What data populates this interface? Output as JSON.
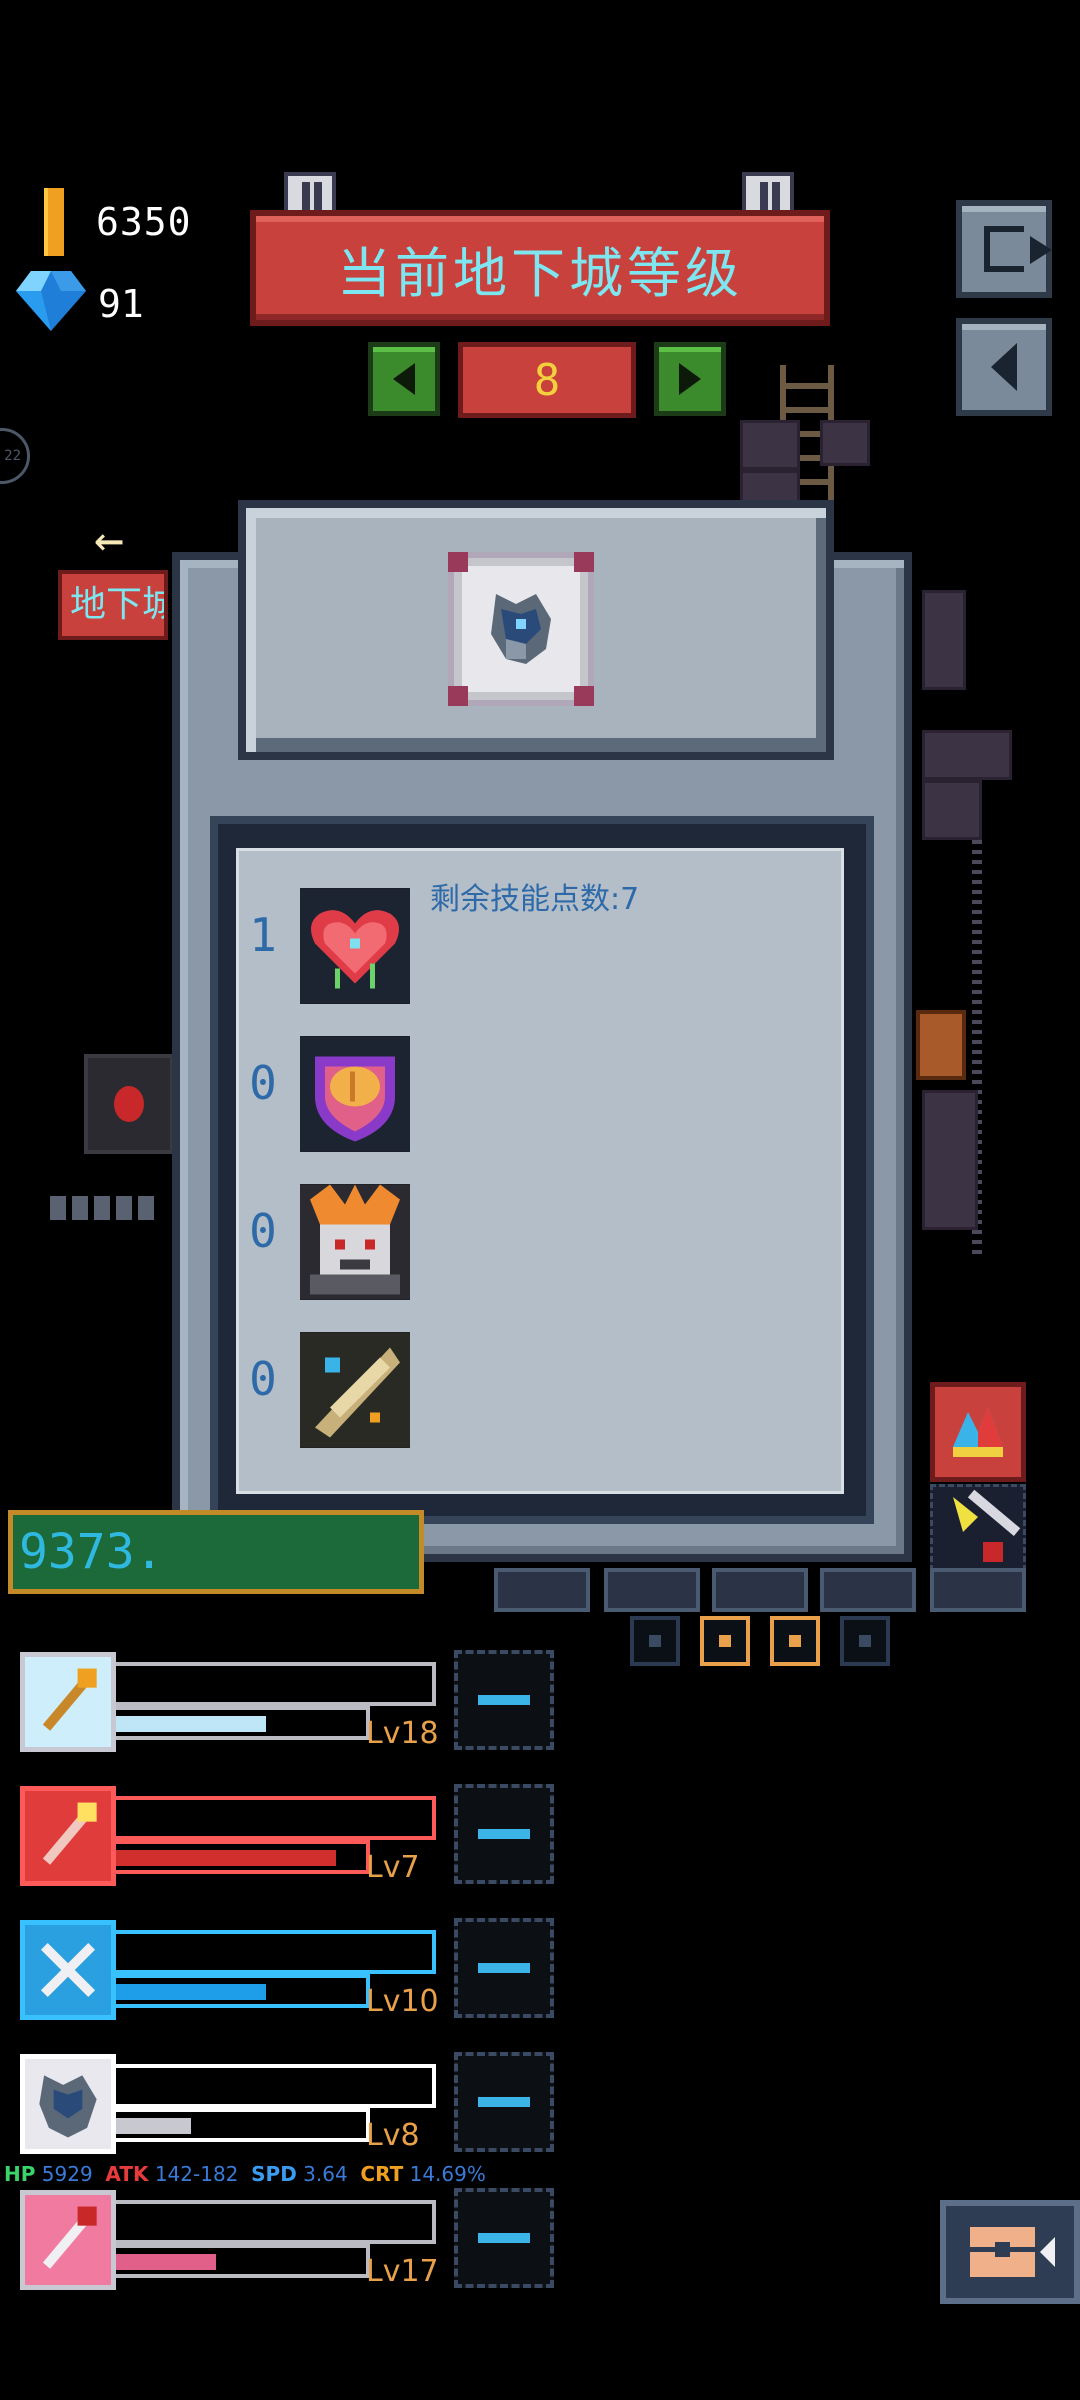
{
  "currency": {
    "gold": "6350",
    "gems": "91"
  },
  "dungeon": {
    "title": "当前地下城等级",
    "level": "8",
    "side_label": "地下城"
  },
  "side_indicator": "22",
  "skill_panel": {
    "remaining_points_label": "剩余技能点数:7",
    "skills": [
      {
        "points": "1",
        "icon": "bleeding-heart-icon"
      },
      {
        "points": "0",
        "icon": "brain-shield-icon"
      },
      {
        "points": "0",
        "icon": "beast-rage-icon"
      },
      {
        "points": "0",
        "icon": "golden-feather-icon"
      }
    ]
  },
  "dps_value": "9373.",
  "heroes": [
    {
      "level": "Lv18",
      "fill": 0.6,
      "color": "#cdeefa",
      "bar_color": "#bfe6f7",
      "border": "#c8c8d2",
      "icon": "golden-staff-icon"
    },
    {
      "level": "Lv7",
      "fill": 0.88,
      "color": "#e03c3c",
      "bar_color": "#d12e2e",
      "border": "#ff5a5a",
      "icon": "flame-staff-icon"
    },
    {
      "level": "Lv10",
      "fill": 0.6,
      "color": "#2aa0e0",
      "bar_color": "#1e9ee8",
      "border": "#38c0ff",
      "icon": "crossbow-icon"
    },
    {
      "level": "Lv8",
      "fill": 0.3,
      "color": "#e8e8ee",
      "bar_color": "#c8c8d0",
      "border": "#ffffff",
      "icon": "armored-beast-icon"
    },
    {
      "level": "Lv17",
      "fill": 0.4,
      "color": "#f07aa0",
      "bar_color": "#e0608a",
      "border": "#c8c8d2",
      "icon": "pink-mace-icon"
    }
  ],
  "stats": {
    "hp_label": "HP",
    "hp": "5929",
    "atk_label": "ATK",
    "atk": "142-182",
    "spd_label": "SPD",
    "spd": "3.64",
    "crt_label": "CRT",
    "crt": "14.69%"
  }
}
